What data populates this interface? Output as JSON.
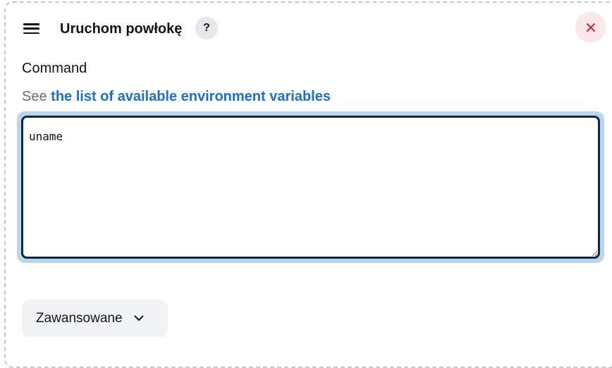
{
  "header": {
    "title": "Uruchom powłokę",
    "help_label": "?"
  },
  "icons": {
    "drag": "drag-handle-icon",
    "close": "close-icon",
    "chevron": "chevron-down-icon"
  },
  "field": {
    "label": "Command",
    "description_prefix": "See ",
    "description_link": "the list of available environment variables",
    "value": "uname"
  },
  "advanced": {
    "label": "Zawansowane"
  },
  "colors": {
    "close_icon": "#d6203b",
    "link": "#1a6fcf",
    "focus_ring": "#bcd6e9",
    "input_border": "#0b2a4a"
  }
}
